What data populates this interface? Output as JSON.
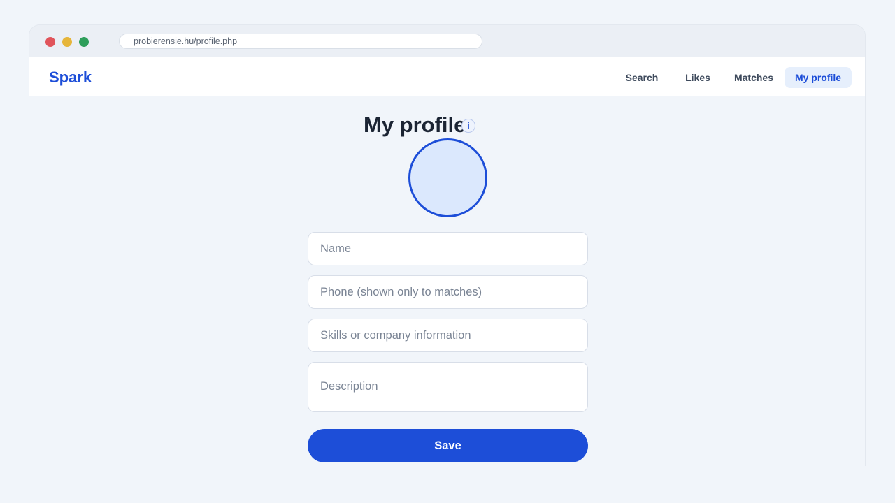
{
  "browser": {
    "url": "probierensie.hu/profile.php"
  },
  "nav": {
    "brand": "Spark",
    "links": [
      "Search",
      "Likes",
      "Matches",
      "My profile"
    ],
    "active": "My profile"
  },
  "main": {
    "title": "My profile",
    "info_icon": "i",
    "avatar_icon": "avatar-placeholder",
    "fields": {
      "name": {
        "value": "",
        "placeholder": "Name"
      },
      "phone": {
        "value": "",
        "placeholder": "Phone (shown only to matches)"
      },
      "skills": {
        "value": "",
        "placeholder": "Skills or company information"
      },
      "description": {
        "value": "",
        "placeholder": "Description"
      }
    },
    "save_label": "Save"
  },
  "colors": {
    "accent": "#1d4ed8",
    "background": "#f1f5fa",
    "avatar_fill": "#dbe8fd",
    "active_nav_bg": "#e6effc"
  }
}
